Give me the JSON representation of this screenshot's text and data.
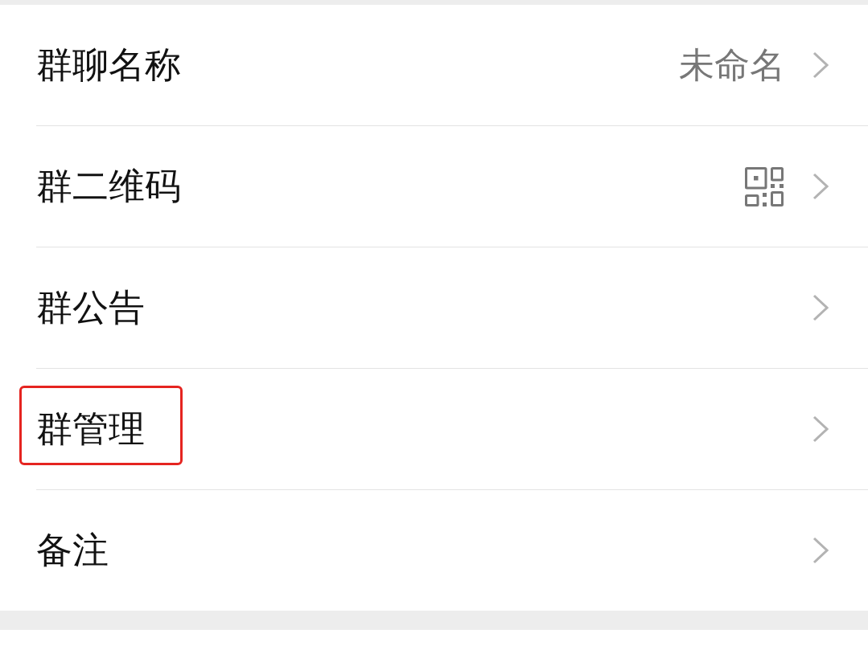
{
  "items": [
    {
      "label": "群聊名称",
      "kind": "value",
      "value": "未命名",
      "highlighted": false
    },
    {
      "label": "群二维码",
      "kind": "qr",
      "highlighted": false
    },
    {
      "label": "群公告",
      "kind": "plain",
      "highlighted": false
    },
    {
      "label": "群管理",
      "kind": "plain",
      "highlighted": true
    },
    {
      "label": "备注",
      "kind": "plain",
      "highlighted": false
    }
  ]
}
